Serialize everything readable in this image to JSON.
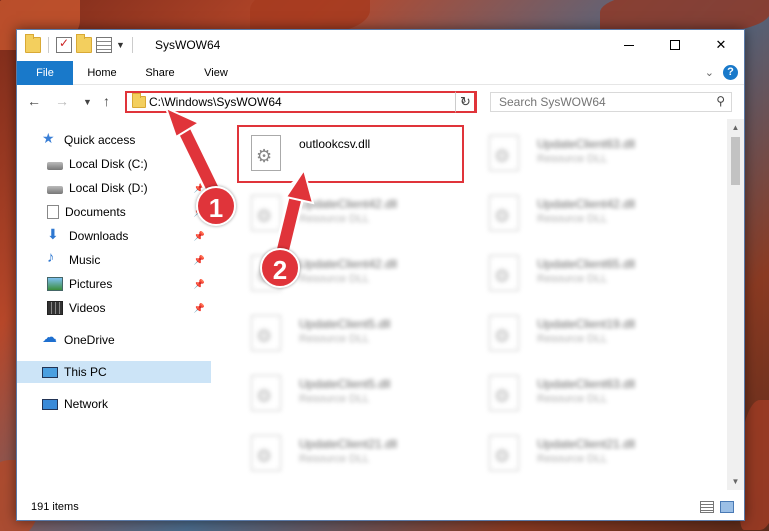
{
  "window": {
    "title": "SysWOW64",
    "controls": {
      "minimize": "",
      "maximize": "",
      "close": "✕"
    }
  },
  "ribbon": {
    "tabs": [
      "File",
      "Home",
      "Share",
      "View"
    ]
  },
  "nav": {
    "address": "C:\\Windows\\SysWOW64",
    "search_placeholder": "Search SysWOW64"
  },
  "sidebar": {
    "items": [
      {
        "label": "Quick access",
        "icon": "star-icon"
      },
      {
        "label": "Local Disk (C:)",
        "icon": "disk-icon",
        "pinned": true
      },
      {
        "label": "Local Disk (D:)",
        "icon": "disk-icon",
        "pinned": true
      },
      {
        "label": "Documents",
        "icon": "document-icon",
        "pinned": true
      },
      {
        "label": "Downloads",
        "icon": "download-icon",
        "pinned": true
      },
      {
        "label": "Music",
        "icon": "music-icon",
        "pinned": true
      },
      {
        "label": "Pictures",
        "icon": "pictures-icon",
        "pinned": true
      },
      {
        "label": "Videos",
        "icon": "videos-icon",
        "pinned": true
      },
      {
        "label": "OneDrive",
        "icon": "cloud-icon"
      },
      {
        "label": "This PC",
        "icon": "computer-icon",
        "selected": true
      },
      {
        "label": "Network",
        "icon": "network-icon"
      }
    ]
  },
  "files": [
    {
      "name": "outlookcsv.dll",
      "type": ""
    },
    {
      "name": "UpdateClient63.dll",
      "type": "Resource DLL"
    },
    {
      "name": "UpdateClient42.dll",
      "type": "Resource DLL"
    },
    {
      "name": "UpdateClient42.dll",
      "type": "Resource DLL"
    },
    {
      "name": "UpdateClient42.dll",
      "type": "Resource DLL"
    },
    {
      "name": "UpdateClient65.dll",
      "type": "Resource DLL"
    },
    {
      "name": "UpdateClient5.dll",
      "type": "Resource DLL"
    },
    {
      "name": "UpdateClient19.dll",
      "type": "Resource DLL"
    },
    {
      "name": "UpdateClient5.dll",
      "type": "Resource DLL"
    },
    {
      "name": "UpdateClient63.dll",
      "type": "Resource DLL"
    },
    {
      "name": "UpdateClient21.dll",
      "type": "Resource DLL"
    },
    {
      "name": "UpdateClient21.dll",
      "type": "Resource DLL"
    }
  ],
  "status": {
    "item_count": "191 items"
  },
  "annotations": {
    "step1": "1",
    "step2": "2"
  },
  "colors": {
    "accent": "#1979ca",
    "annotation": "#e0343a",
    "selection": "#cce4f7"
  }
}
